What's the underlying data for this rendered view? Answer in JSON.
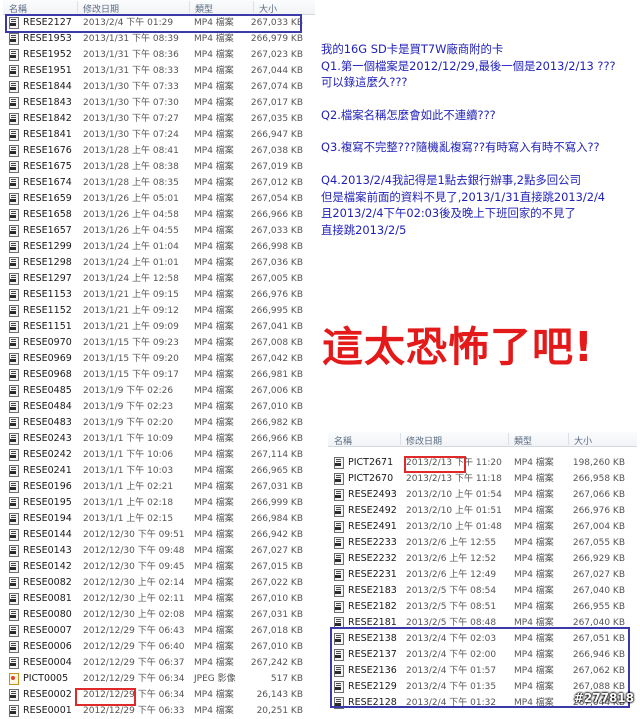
{
  "left_list": {
    "headers": {
      "name": "名稱",
      "date": "修改日期",
      "type": "類型",
      "size": "大小"
    },
    "rows": [
      {
        "name": "RESE2127",
        "date": "2013/2/4 下午 01:29",
        "type": "MP4 檔案",
        "size": "267,033 KB",
        "icon": "mp4-file-icon"
      },
      {
        "name": "RESE1953",
        "date": "2013/1/31 下午 08:39",
        "type": "MP4 檔案",
        "size": "266,979 KB",
        "icon": "mp4-file-icon"
      },
      {
        "name": "RESE1952",
        "date": "2013/1/31 下午 08:36",
        "type": "MP4 檔案",
        "size": "267,023 KB",
        "icon": "mp4-file-icon"
      },
      {
        "name": "RESE1951",
        "date": "2013/1/31 下午 08:33",
        "type": "MP4 檔案",
        "size": "267,044 KB",
        "icon": "mp4-file-icon"
      },
      {
        "name": "RESE1844",
        "date": "2013/1/30 下午 07:33",
        "type": "MP4 檔案",
        "size": "267,074 KB",
        "icon": "mp4-file-icon"
      },
      {
        "name": "RESE1843",
        "date": "2013/1/30 下午 07:30",
        "type": "MP4 檔案",
        "size": "267,017 KB",
        "icon": "mp4-file-icon"
      },
      {
        "name": "RESE1842",
        "date": "2013/1/30 下午 07:27",
        "type": "MP4 檔案",
        "size": "267,035 KB",
        "icon": "mp4-file-icon"
      },
      {
        "name": "RESE1841",
        "date": "2013/1/30 下午 07:24",
        "type": "MP4 檔案",
        "size": "266,947 KB",
        "icon": "mp4-file-icon"
      },
      {
        "name": "RESE1676",
        "date": "2013/1/28 上午 08:41",
        "type": "MP4 檔案",
        "size": "267,038 KB",
        "icon": "mp4-file-icon"
      },
      {
        "name": "RESE1675",
        "date": "2013/1/28 上午 08:38",
        "type": "MP4 檔案",
        "size": "267,019 KB",
        "icon": "mp4-file-icon"
      },
      {
        "name": "RESE1674",
        "date": "2013/1/28 上午 08:35",
        "type": "MP4 檔案",
        "size": "267,012 KB",
        "icon": "mp4-file-icon"
      },
      {
        "name": "RESE1659",
        "date": "2013/1/26 上午 05:01",
        "type": "MP4 檔案",
        "size": "267,054 KB",
        "icon": "mp4-file-icon"
      },
      {
        "name": "RESE1658",
        "date": "2013/1/26 上午 04:58",
        "type": "MP4 檔案",
        "size": "266,966 KB",
        "icon": "mp4-file-icon"
      },
      {
        "name": "RESE1657",
        "date": "2013/1/26 上午 04:55",
        "type": "MP4 檔案",
        "size": "267,033 KB",
        "icon": "mp4-file-icon"
      },
      {
        "name": "RESE1299",
        "date": "2013/1/24 上午 01:04",
        "type": "MP4 檔案",
        "size": "266,998 KB",
        "icon": "mp4-file-icon"
      },
      {
        "name": "RESE1298",
        "date": "2013/1/24 上午 01:01",
        "type": "MP4 檔案",
        "size": "267,036 KB",
        "icon": "mp4-file-icon"
      },
      {
        "name": "RESE1297",
        "date": "2013/1/24 上午 12:58",
        "type": "MP4 檔案",
        "size": "267,005 KB",
        "icon": "mp4-file-icon"
      },
      {
        "name": "RESE1153",
        "date": "2013/1/21 上午 09:15",
        "type": "MP4 檔案",
        "size": "266,976 KB",
        "icon": "mp4-file-icon"
      },
      {
        "name": "RESE1152",
        "date": "2013/1/21 上午 09:12",
        "type": "MP4 檔案",
        "size": "266,995 KB",
        "icon": "mp4-file-icon"
      },
      {
        "name": "RESE1151",
        "date": "2013/1/21 上午 09:09",
        "type": "MP4 檔案",
        "size": "267,041 KB",
        "icon": "mp4-file-icon"
      },
      {
        "name": "RESE0970",
        "date": "2013/1/15 下午 09:23",
        "type": "MP4 檔案",
        "size": "267,008 KB",
        "icon": "mp4-file-icon"
      },
      {
        "name": "RESE0969",
        "date": "2013/1/15 下午 09:20",
        "type": "MP4 檔案",
        "size": "267,042 KB",
        "icon": "mp4-file-icon"
      },
      {
        "name": "RESE0968",
        "date": "2013/1/15 下午 09:17",
        "type": "MP4 檔案",
        "size": "266,981 KB",
        "icon": "mp4-file-icon"
      },
      {
        "name": "RESE0485",
        "date": "2013/1/9 下午 02:26",
        "type": "MP4 檔案",
        "size": "267,006 KB",
        "icon": "mp4-file-icon"
      },
      {
        "name": "RESE0484",
        "date": "2013/1/9 下午 02:23",
        "type": "MP4 檔案",
        "size": "267,010 KB",
        "icon": "mp4-file-icon"
      },
      {
        "name": "RESE0483",
        "date": "2013/1/9 下午 02:20",
        "type": "MP4 檔案",
        "size": "266,982 KB",
        "icon": "mp4-file-icon"
      },
      {
        "name": "RESE0243",
        "date": "2013/1/1 下午 10:09",
        "type": "MP4 檔案",
        "size": "266,966 KB",
        "icon": "mp4-file-icon"
      },
      {
        "name": "RESE0242",
        "date": "2013/1/1 下午 10:06",
        "type": "MP4 檔案",
        "size": "267,114 KB",
        "icon": "mp4-file-icon"
      },
      {
        "name": "RESE0241",
        "date": "2013/1/1 下午 10:03",
        "type": "MP4 檔案",
        "size": "266,965 KB",
        "icon": "mp4-file-icon"
      },
      {
        "name": "RESE0196",
        "date": "2013/1/1 上午 02:21",
        "type": "MP4 檔案",
        "size": "267,031 KB",
        "icon": "mp4-file-icon"
      },
      {
        "name": "RESE0195",
        "date": "2013/1/1 上午 02:18",
        "type": "MP4 檔案",
        "size": "266,999 KB",
        "icon": "mp4-file-icon"
      },
      {
        "name": "RESE0194",
        "date": "2013/1/1 上午 02:15",
        "type": "MP4 檔案",
        "size": "266,984 KB",
        "icon": "mp4-file-icon"
      },
      {
        "name": "RESE0144",
        "date": "2012/12/30 下午 09:51",
        "type": "MP4 檔案",
        "size": "266,942 KB",
        "icon": "mp4-file-icon"
      },
      {
        "name": "RESE0143",
        "date": "2012/12/30 下午 09:48",
        "type": "MP4 檔案",
        "size": "267,027 KB",
        "icon": "mp4-file-icon"
      },
      {
        "name": "RESE0142",
        "date": "2012/12/30 下午 09:45",
        "type": "MP4 檔案",
        "size": "267,015 KB",
        "icon": "mp4-file-icon"
      },
      {
        "name": "RESE0082",
        "date": "2012/12/30 上午 02:14",
        "type": "MP4 檔案",
        "size": "267,022 KB",
        "icon": "mp4-file-icon"
      },
      {
        "name": "RESE0081",
        "date": "2012/12/30 上午 02:11",
        "type": "MP4 檔案",
        "size": "267,010 KB",
        "icon": "mp4-file-icon"
      },
      {
        "name": "RESE0080",
        "date": "2012/12/30 上午 02:08",
        "type": "MP4 檔案",
        "size": "267,031 KB",
        "icon": "mp4-file-icon"
      },
      {
        "name": "RESE0007",
        "date": "2012/12/29 下午 06:43",
        "type": "MP4 檔案",
        "size": "267,018 KB",
        "icon": "mp4-file-icon"
      },
      {
        "name": "RESE0006",
        "date": "2012/12/29 下午 06:40",
        "type": "MP4 檔案",
        "size": "267,010 KB",
        "icon": "mp4-file-icon"
      },
      {
        "name": "RESE0004",
        "date": "2012/12/29 下午 06:37",
        "type": "MP4 檔案",
        "size": "267,242 KB",
        "icon": "mp4-file-icon"
      },
      {
        "name": "PICT0005",
        "date": "2012/12/29 下午 06:34",
        "type": "JPEG 影像",
        "size": "517 KB",
        "icon": "jpeg-file-icon"
      },
      {
        "name": "RESE0002",
        "date": "2012/12/29 下午 06:34",
        "type": "MP4 檔案",
        "size": "26,143 KB",
        "icon": "mp4-file-icon"
      },
      {
        "name": "RESE0001",
        "date": "2012/12/29 下午 06:33",
        "type": "MP4 檔案",
        "size": "20,251 KB",
        "icon": "mp4-file-icon"
      }
    ]
  },
  "right_list": {
    "headers": {
      "name": "名稱",
      "date": "修改日期",
      "type": "類型",
      "size": "大小"
    },
    "rows": [
      {
        "name": "PICT2671",
        "date": "2013/2/13 下午 11:20",
        "type": "MP4 檔案",
        "size": "198,260 KB",
        "icon": "mp4-file-icon"
      },
      {
        "name": "PICT2670",
        "date": "2013/2/13 下午 11:18",
        "type": "MP4 檔案",
        "size": "266,958 KB",
        "icon": "mp4-file-icon"
      },
      {
        "name": "RESE2493",
        "date": "2013/2/10 上午 01:54",
        "type": "MP4 檔案",
        "size": "267,066 KB",
        "icon": "mp4-file-icon"
      },
      {
        "name": "RESE2492",
        "date": "2013/2/10 上午 01:51",
        "type": "MP4 檔案",
        "size": "266,976 KB",
        "icon": "mp4-file-icon"
      },
      {
        "name": "RESE2491",
        "date": "2013/2/10 上午 01:48",
        "type": "MP4 檔案",
        "size": "267,004 KB",
        "icon": "mp4-file-icon"
      },
      {
        "name": "RESE2233",
        "date": "2013/2/6 上午 12:55",
        "type": "MP4 檔案",
        "size": "267,055 KB",
        "icon": "mp4-file-icon"
      },
      {
        "name": "RESE2232",
        "date": "2013/2/6 上午 12:52",
        "type": "MP4 檔案",
        "size": "266,929 KB",
        "icon": "mp4-file-icon"
      },
      {
        "name": "RESE2231",
        "date": "2013/2/6 上午 12:49",
        "type": "MP4 檔案",
        "size": "267,027 KB",
        "icon": "mp4-file-icon"
      },
      {
        "name": "RESE2183",
        "date": "2013/2/5 下午 08:54",
        "type": "MP4 檔案",
        "size": "267,040 KB",
        "icon": "mp4-file-icon"
      },
      {
        "name": "RESE2182",
        "date": "2013/2/5 下午 08:51",
        "type": "MP4 檔案",
        "size": "266,955 KB",
        "icon": "mp4-file-icon"
      },
      {
        "name": "RESE2181",
        "date": "2013/2/5 下午 08:48",
        "type": "MP4 檔案",
        "size": "267,040 KB",
        "icon": "mp4-file-icon"
      },
      {
        "name": "RESE2138",
        "date": "2013/2/4 下午 02:03",
        "type": "MP4 檔案",
        "size": "267,051 KB",
        "icon": "mp4-file-icon"
      },
      {
        "name": "RESE2137",
        "date": "2013/2/4 下午 02:00",
        "type": "MP4 檔案",
        "size": "266,946 KB",
        "icon": "mp4-file-icon"
      },
      {
        "name": "RESE2136",
        "date": "2013/2/4 下午 01:57",
        "type": "MP4 檔案",
        "size": "267,062 KB",
        "icon": "mp4-file-icon"
      },
      {
        "name": "RESE2129",
        "date": "2013/2/4 下午 01:35",
        "type": "MP4 檔案",
        "size": "267,088 KB",
        "icon": "mp4-file-icon"
      },
      {
        "name": "RESE2128",
        "date": "2013/2/4 下午 01:32",
        "type": "MP4 檔案",
        "size": "267,044 KB",
        "icon": "mp4-file-icon"
      }
    ]
  },
  "notes": {
    "line1": "我的16G SD卡是買T7W廠商附的卡",
    "q1_line1": "Q1.第一個檔案是2012/12/29,最後一個是2013/2/13 ???",
    "q1_line2": "可以錄這麼久???",
    "q2": "Q2.檔案名稱怎麼會如此不連續???",
    "q3": "Q3.複寫不完整???隨機亂複寫??有時寫入有時不寫入??",
    "q4_line1": "Q4.2013/2/4我記得是1點去銀行辦事,2點多回公司",
    "q4_line2": "但是檔案前面的資料不見了,2013/1/31直接跳2013/2/4",
    "q4_line3": "且2013/2/4下午02:03後及晚上下班回家的不見了",
    "q4_line4": "直接跳2013/2/5"
  },
  "exclaim": "這太恐怖了吧!",
  "watermark": "#277818",
  "colors": {
    "highlight_blue": "#3a3aa8",
    "highlight_red": "#e0292a",
    "note_text": "#1f1fb8",
    "exclaim": "#e41a1a"
  }
}
